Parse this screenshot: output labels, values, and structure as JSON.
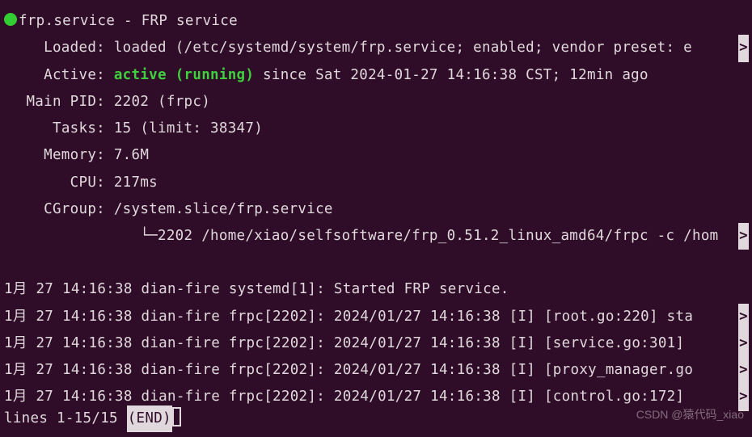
{
  "header": {
    "unit_name": "frp.service",
    "unit_desc": "FRP service"
  },
  "status": {
    "loaded_label": "Loaded:",
    "loaded_value": "loaded (/etc/systemd/system/frp.service; enabled; vendor preset: e",
    "active_label": "Active:",
    "active_state": "active (running)",
    "active_since": " since Sat 2024-01-27 14:16:38 CST; 12min ago",
    "mainpid_label": "Main PID:",
    "mainpid_value": "2202 (frpc)",
    "tasks_label": "Tasks:",
    "tasks_value": "15 (limit: 38347)",
    "memory_label": "Memory:",
    "memory_value": "7.6M",
    "cpu_label": "CPU:",
    "cpu_value": "217ms",
    "cgroup_label": "CGroup:",
    "cgroup_value": "/system.slice/frp.service",
    "cgroup_tree": "└─",
    "cgroup_process": "2202 /home/xiao/selfsoftware/frp_0.51.2_linux_amd64/frpc -c /hom"
  },
  "log_prefix": "1月 27 14:16:38 dian-fire ",
  "logs": [
    {
      "src": "systemd[1]:",
      "msg": " Started FRP service."
    },
    {
      "src": "frpc[2202]:",
      "msg": " 2024/01/27 14:16:38 [I] [root.go:220] sta",
      "cont": true
    },
    {
      "src": "frpc[2202]:",
      "msg": " 2024/01/27 14:16:38 [I] [service.go:301] ",
      "cont": true
    },
    {
      "src": "frpc[2202]:",
      "msg": " 2024/01/27 14:16:38 [I] [proxy_manager.go",
      "cont": true
    },
    {
      "src": "frpc[2202]:",
      "msg": " 2024/01/27 14:16:38 [I] [control.go:172] ",
      "cont": true
    }
  ],
  "pager": {
    "lines": "lines 1-15/15 ",
    "end": "(END)"
  },
  "continuation_glyph": ">",
  "watermark": "CSDN @猿代码_xiao"
}
